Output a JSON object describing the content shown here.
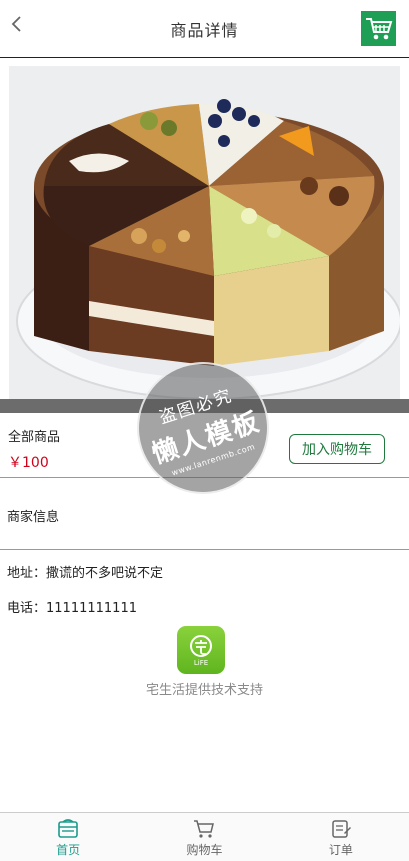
{
  "header": {
    "title": "商品详情"
  },
  "product": {
    "name": "全部商品",
    "price": "￥100",
    "add_to_cart_label": "加入购物车"
  },
  "merchant": {
    "label": "商家信息",
    "address": "地址：撒谎的不多吧说不定",
    "phone": "电话：11111111111"
  },
  "footer_brand": {
    "logo_text": "LiFE",
    "support_text": "宅生活提供技术支持"
  },
  "watermark": {
    "top": "盗图必究",
    "main": "懒人模板",
    "url": "www.lanrenmb.com"
  },
  "nav": {
    "items": [
      {
        "label": "首页",
        "icon": "home-icon",
        "active": true
      },
      {
        "label": "购物车",
        "icon": "cart-icon",
        "active": false
      },
      {
        "label": "订单",
        "icon": "order-icon",
        "active": false
      }
    ]
  },
  "colors": {
    "accent_green": "#1f9e56",
    "price_red": "#d0021b",
    "nav_active": "#1c9c8c"
  }
}
